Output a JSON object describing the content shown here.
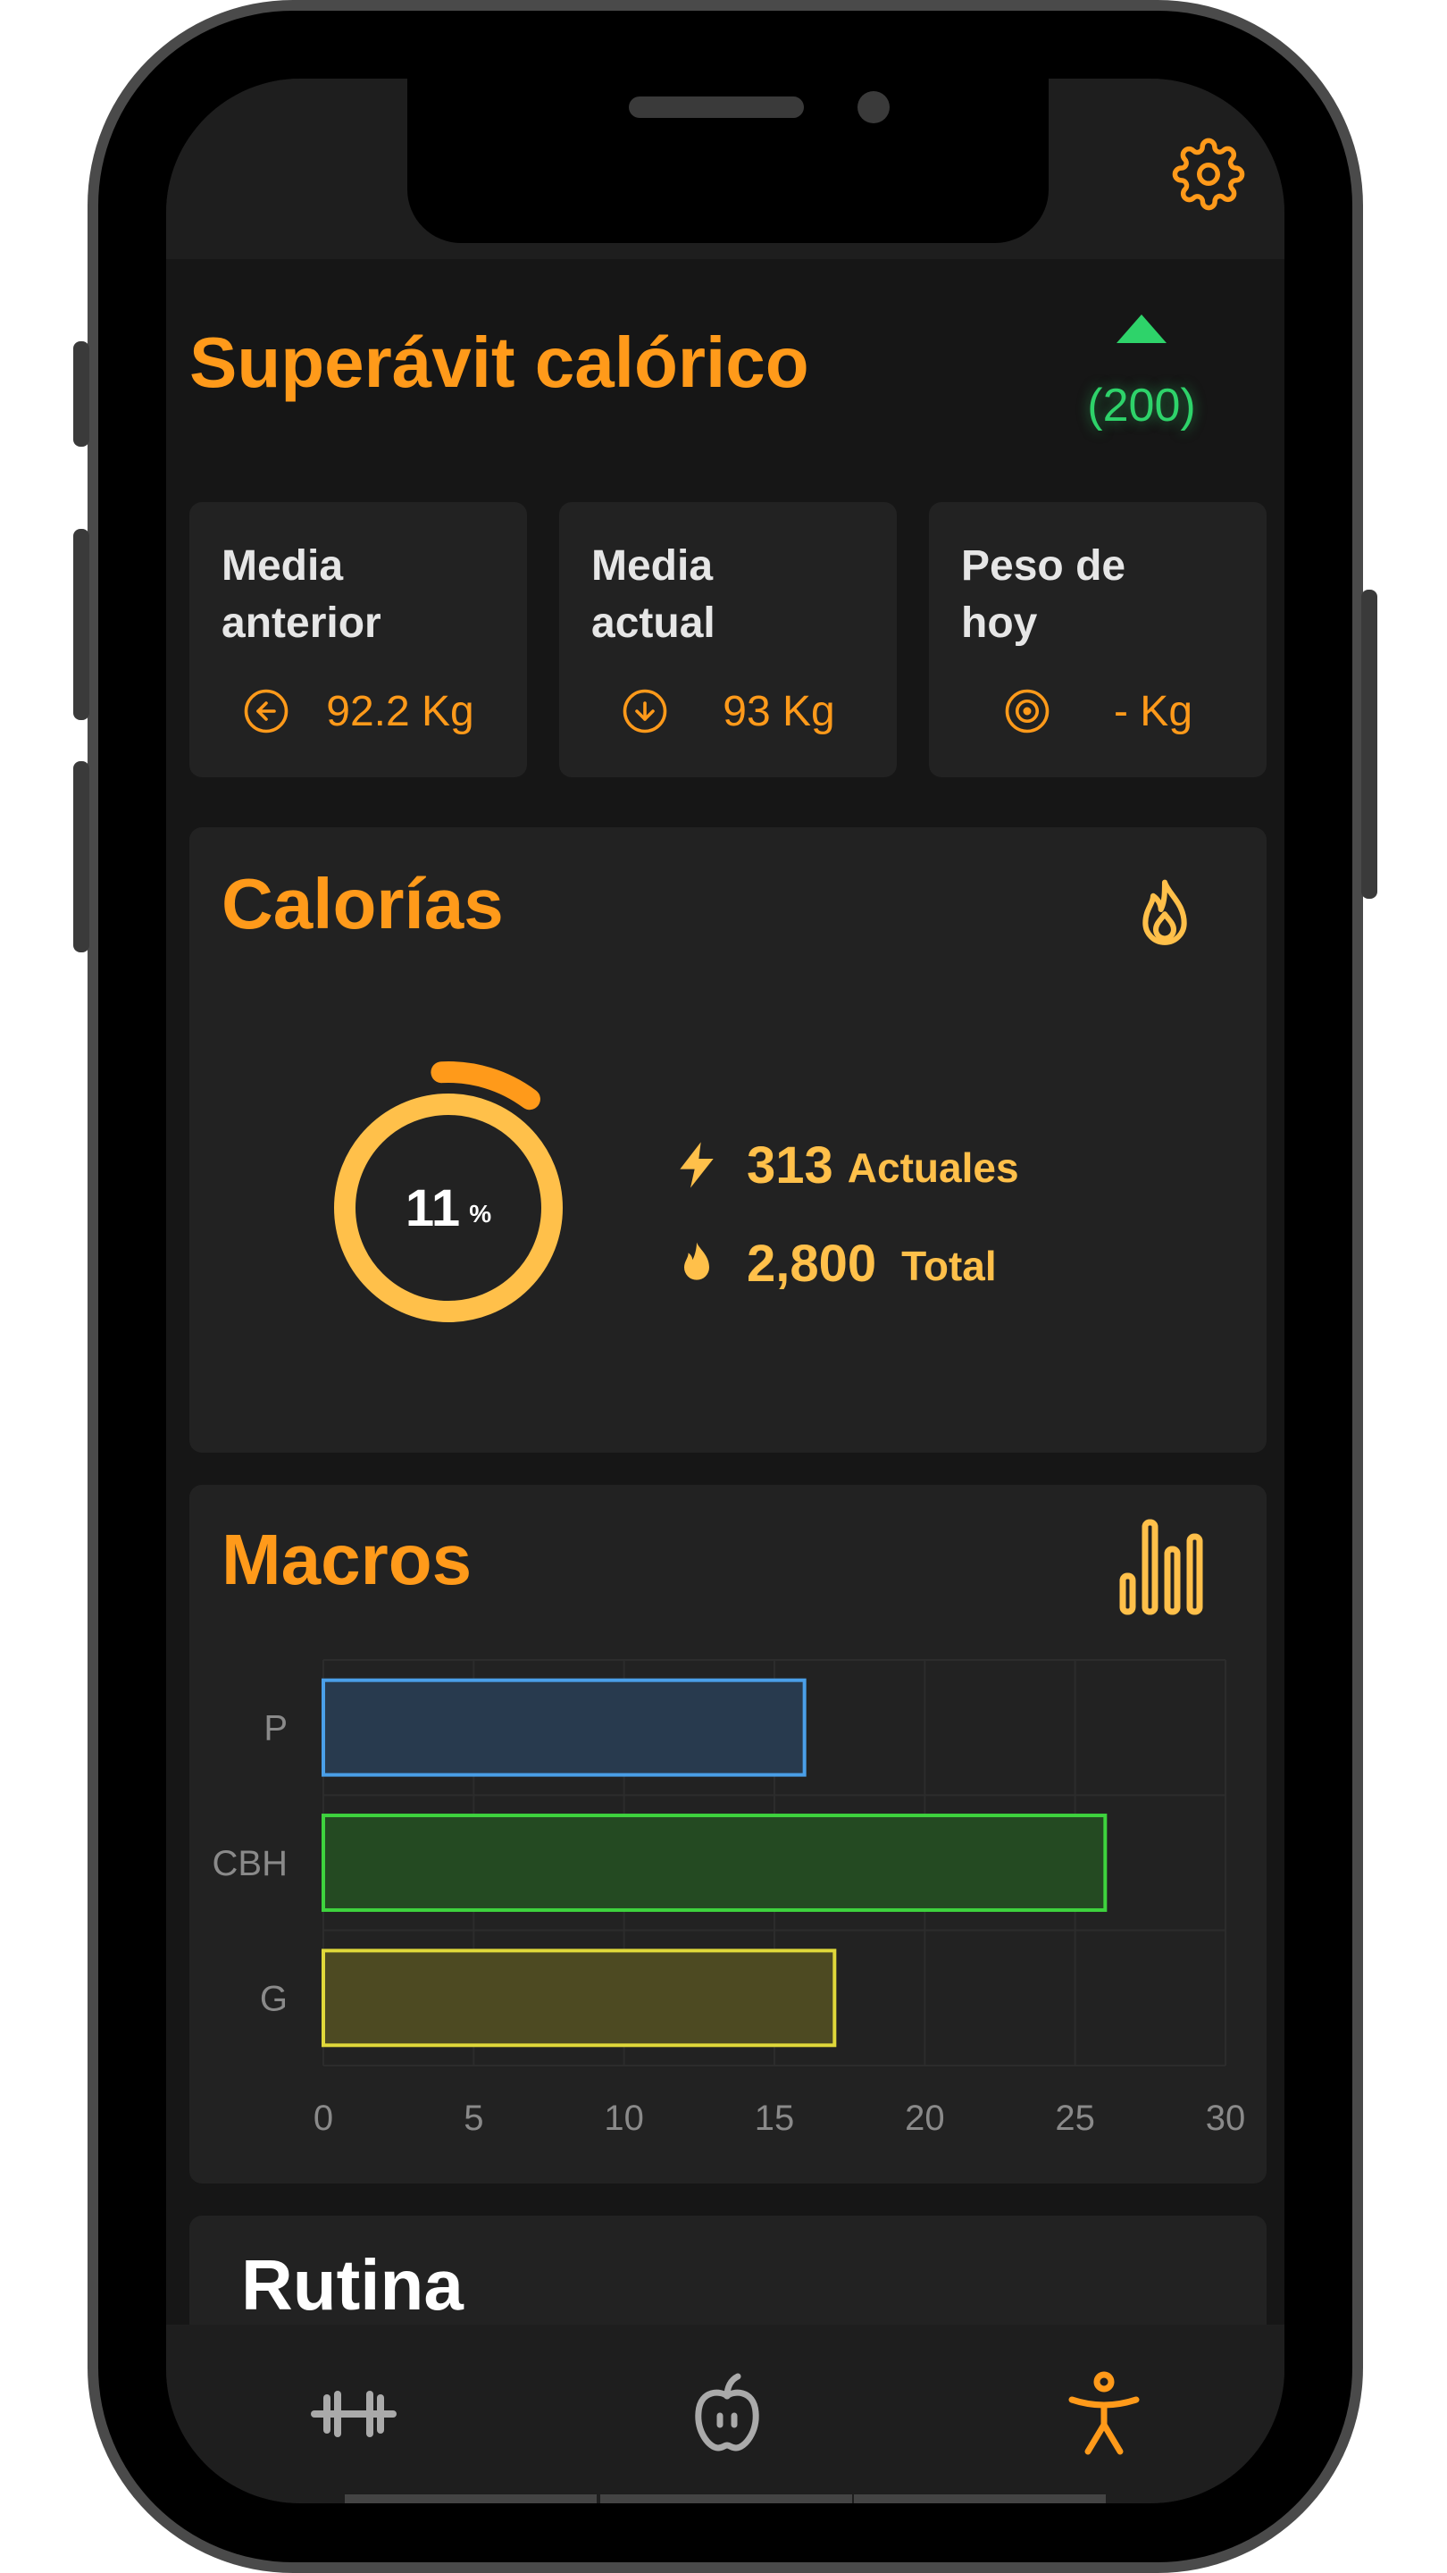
{
  "header": {
    "settings_icon": "gear-icon"
  },
  "balance": {
    "title": "Superávit calórico",
    "trend_icon": "triangle-up-icon",
    "value": "(200)"
  },
  "stats": [
    {
      "label_line1": "Media",
      "label_line2": "anterior",
      "icon": "arrow-left-circle-icon",
      "value": "92.2 Kg"
    },
    {
      "label_line1": "Media",
      "label_line2": "actual",
      "icon": "arrow-down-circle-icon",
      "value": "93 Kg"
    },
    {
      "label_line1": "Peso de",
      "label_line2": "hoy",
      "icon": "target-icon",
      "value": "- Kg"
    }
  ],
  "calories": {
    "title": "Calorías",
    "icon": "flame-icon",
    "percent": "11",
    "percent_unit": "%",
    "progress_fraction": 0.11,
    "current_value": "313",
    "current_label": "Actuales",
    "total_value": "2,800",
    "total_label": "Total"
  },
  "macros": {
    "title": "Macros",
    "icon": "bar-chart-icon"
  },
  "chart_data": {
    "type": "bar",
    "orientation": "horizontal",
    "categories": [
      "P",
      "CBH",
      "G"
    ],
    "values": [
      16,
      26,
      17
    ],
    "colors": [
      "#4a9fe8",
      "#3ed33e",
      "#e0d83a"
    ],
    "fill_colors": [
      "#283a4e",
      "#244a22",
      "#4d4a22"
    ],
    "xlim": [
      0,
      30
    ],
    "xticks": [
      0,
      5,
      10,
      15,
      20,
      25,
      30
    ],
    "grid": true
  },
  "routine": {
    "title": "Rutina"
  },
  "tabbar": {
    "items": [
      {
        "icon": "dumbbell-icon",
        "active": false
      },
      {
        "icon": "apple-icon",
        "active": false
      },
      {
        "icon": "accessibility-icon",
        "active": true
      }
    ]
  },
  "colors": {
    "accent": "#ff9a1a",
    "accent_light": "#ffc04a",
    "positive": "#2ed36a",
    "background": "#161616",
    "card": "#222222"
  }
}
